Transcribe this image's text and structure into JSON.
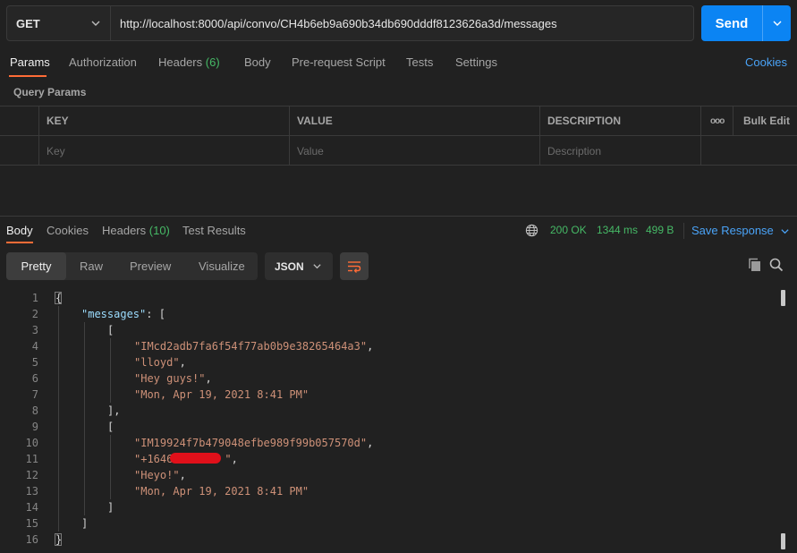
{
  "request": {
    "method": "GET",
    "url": "http://localhost:8000/api/convo/CH4b6eb9a690b34db690dddf8123626a3d/messages",
    "send_label": "Send"
  },
  "req_tabs": {
    "params": "Params",
    "authorization": "Authorization",
    "headers": "Headers",
    "headers_count": "(6)",
    "body": "Body",
    "prerequest": "Pre-request Script",
    "tests": "Tests",
    "settings": "Settings",
    "cookies": "Cookies"
  },
  "query_params": {
    "label": "Query Params",
    "headers": {
      "key": "KEY",
      "value": "VALUE",
      "description": "DESCRIPTION",
      "more": "ooo",
      "bulk_edit": "Bulk Edit"
    },
    "placeholders": {
      "key": "Key",
      "value": "Value",
      "description": "Description"
    }
  },
  "response": {
    "tabs": {
      "body": "Body",
      "cookies": "Cookies",
      "headers": "Headers",
      "headers_count": "(10)",
      "test_results": "Test Results"
    },
    "status": "200 OK",
    "time": "1344 ms",
    "size": "499 B",
    "save_label": "Save Response",
    "views": [
      "Pretty",
      "Raw",
      "Preview",
      "Visualize"
    ],
    "format": "JSON"
  },
  "code": {
    "line_numbers": [
      "1",
      "2",
      "3",
      "4",
      "5",
      "6",
      "7",
      "8",
      "9",
      "10",
      "11",
      "12",
      "13",
      "14",
      "15",
      "16"
    ],
    "open_brace": "{",
    "key": "\"messages\"",
    "colon_bracket": ": [",
    "open_bracket": "[",
    "m1_id": "\"IMcd2adb7fa6f54f77ab0b9e38265464a3\"",
    "m1_author": "\"lloyd\"",
    "m1_body": "\"Hey guys!\"",
    "m1_date": "\"Mon, Apr 19, 2021 8:41 PM\"",
    "close_bracket_comma": "],",
    "m2_id": "\"IM19924f7b479048efbe989f99b057570d\"",
    "m2_author_prefix": "\"+1646",
    "m2_author_suffix": "\"",
    "m2_body": "\"Heyo!\"",
    "m2_date": "\"Mon, Apr 19, 2021 8:41 PM\"",
    "close_bracket": "]",
    "comma": ",",
    "close_brace": "}"
  },
  "colors": {
    "accent": "#ff6c37",
    "primary": "#0b84f3",
    "success": "#46b966",
    "link": "#4aa3f7"
  }
}
